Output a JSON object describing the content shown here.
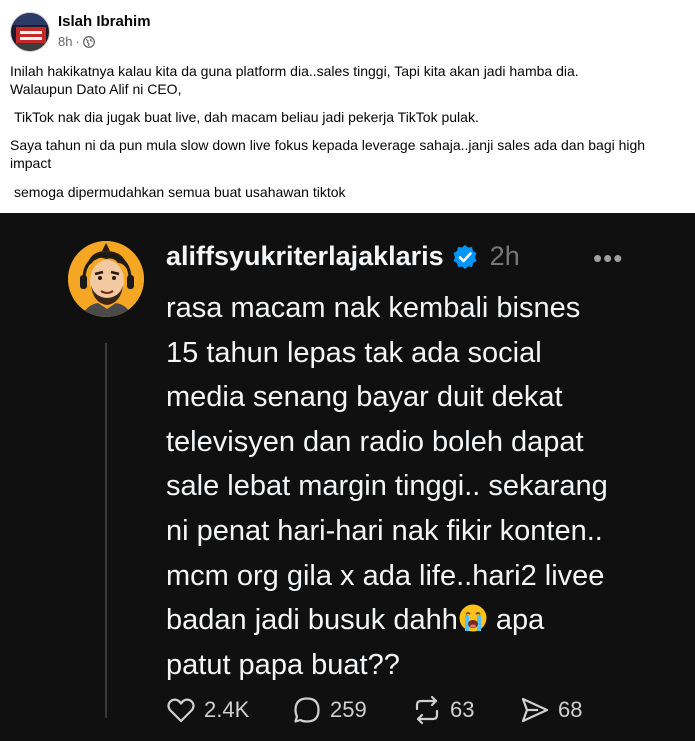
{
  "post": {
    "author": "Islah Ibrahim",
    "time": "8h",
    "separator": "·",
    "paragraphs": [
      "Inilah hakikatnya kalau kita da guna platform dia..sales tinggi, Tapi kita akan jadi hamba dia.\nWalaupun Dato Alif ni CEO,",
      "TikTok nak dia jugak buat live, dah macam beliau jadi pekerja TikTok pulak.",
      "Saya tahun ni da pun mula slow down live fokus kepada  leverage sahaja..janji sales ada dan bagi high impact",
      "semoga dipermudahkan semua buat usahawan tiktok"
    ]
  },
  "thread": {
    "username": "aliffsyukriterlajaklaris",
    "time": "2h",
    "more": "•••",
    "lines": [
      "rasa macam nak kembali bisnes",
      "15 tahun lepas tak ada social",
      "media senang bayar duit dekat",
      "televisyen dan radio boleh dapat",
      "sale lebat margin tinggi.. sekarang",
      "ni penat hari-hari nak fikir konten..",
      "mcm org gila x ada life..hari2 livee",
      "badan jadi busuk dahh",
      "apa",
      "patut papa buat??"
    ],
    "stats": {
      "likes": "2.4K",
      "replies": "259",
      "reposts": "63",
      "shares": "68"
    }
  },
  "icons": {
    "avatar": "profile-photo",
    "globe": "globe-icon",
    "verified": "verified-badge-icon",
    "emoji": "crying-face-emoji",
    "like": "heart-icon",
    "reply": "comment-icon",
    "repost": "repost-icon",
    "share": "send-icon"
  },
  "colors": {
    "threads_bg": "#101010",
    "verified_blue": "#0095f6",
    "fb_meta": "#65676b"
  }
}
